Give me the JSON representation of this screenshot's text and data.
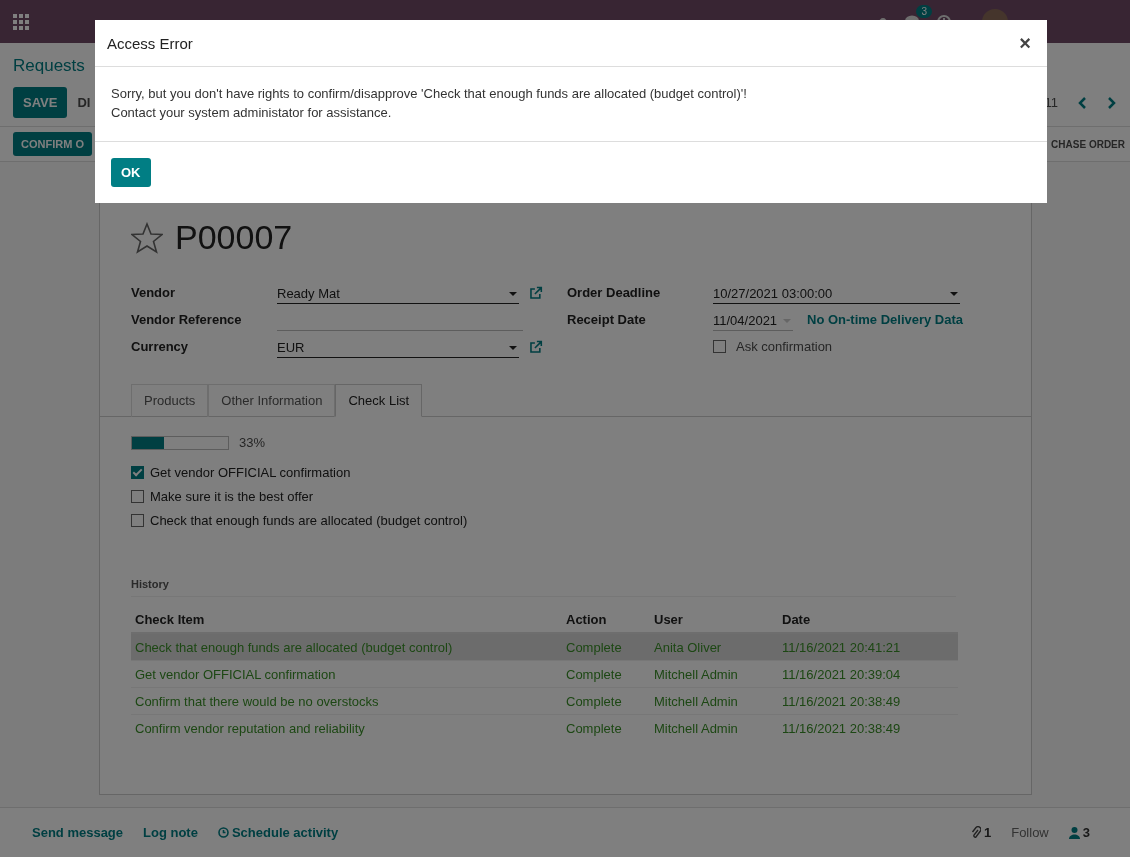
{
  "navbar": {
    "messages_badge": "3"
  },
  "breadcrumb": "Requests",
  "buttons": [
    {
      "label": "SAVE",
      "kind": "primary"
    },
    {
      "label": "DI",
      "kind": "link"
    }
  ],
  "pager": {
    "value": "11"
  },
  "status_buttons": [
    {
      "label": "CONFIRM O",
      "kind": "primary"
    },
    {
      "label": "CHASE ORDER",
      "kind": "link"
    }
  ],
  "form": {
    "favorite": false,
    "name": "P00007",
    "left_fields": [
      {
        "label": "Vendor",
        "kind": "many2one",
        "value": "Ready Mat"
      },
      {
        "label": "Vendor Reference",
        "kind": "text"
      },
      {
        "label": "Currency",
        "kind": "many2one",
        "value": "EUR"
      }
    ],
    "right_fields": [
      {
        "label": "Order Deadline",
        "kind": "datetime",
        "value": "10/27/2021 03:00:00"
      },
      {
        "label": "Receipt Date",
        "kind": "date",
        "value": "11/04/2021",
        "note": "No On-time Delivery Data"
      },
      {
        "kind": "checkbox",
        "label": "Ask confirmation",
        "checked": false
      }
    ]
  },
  "tabs": [
    {
      "label": "Products",
      "selected": false
    },
    {
      "label": "Other Information",
      "selected": false
    },
    {
      "label": "Check List",
      "selected": true
    }
  ],
  "progress": {
    "level": 0.33,
    "reading": "33%"
  },
  "checklist": [
    {
      "label": "Get vendor OFFICIAL confirmation",
      "checked": true
    },
    {
      "label": "Make sure it is the best offer",
      "checked": false
    },
    {
      "label": "Check that enough funds are allocated (budget control)",
      "checked": false
    }
  ],
  "history": {
    "title": "History",
    "columns": [
      "Check Item",
      "Action",
      "User",
      "Date"
    ],
    "rows": [
      {
        "cells": [
          "Check that enough funds are allocated (budget control)",
          "Complete",
          "Anita Oliver",
          "11/16/2021 20:41:21"
        ],
        "selected": true
      },
      {
        "cells": [
          "Get vendor OFFICIAL confirmation",
          "Complete",
          "Mitchell Admin",
          "11/16/2021 20:39:04"
        ],
        "selected": false
      },
      {
        "cells": [
          "Confirm that there would be no overstocks",
          "Complete",
          "Mitchell Admin",
          "11/16/2021 20:38:49"
        ],
        "selected": false
      },
      {
        "cells": [
          "Confirm vendor reputation and reliability",
          "Complete",
          "Mitchell Admin",
          "11/16/2021 20:38:49"
        ],
        "selected": false
      }
    ]
  },
  "chatter": {
    "actions": [
      {
        "label": "Send message",
        "kind": "plain"
      },
      {
        "label": "Log note",
        "kind": "plain"
      },
      {
        "label": "Schedule activity",
        "kind": "clock"
      }
    ],
    "attachments": "1",
    "follow": "Follow",
    "followers": "3"
  },
  "dialog": {
    "title": "Access Error",
    "close": "×",
    "message": [
      "Sorry, but you don't have rights to confirm/disapprove 'Check that enough funds are allocated (budget control)'!",
      "Contact your system administator for assistance."
    ],
    "button": "OK"
  }
}
